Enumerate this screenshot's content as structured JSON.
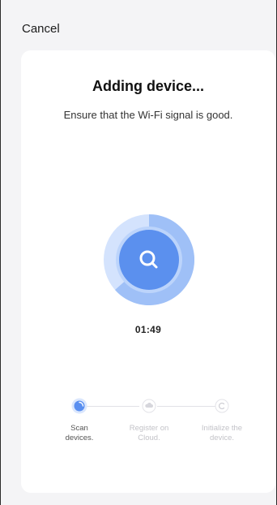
{
  "header": {
    "cancel_label": "Cancel"
  },
  "card": {
    "title": "Adding device...",
    "subtitle": "Ensure that the Wi-Fi signal is good.",
    "timer": "01:49"
  },
  "steps": [
    {
      "label_line1": "Scan",
      "label_line2": "devices.",
      "state": "active",
      "icon": "scan-dot-icon"
    },
    {
      "label_line1": "Register on",
      "label_line2": "Cloud.",
      "state": "pending",
      "icon": "cloud-icon"
    },
    {
      "label_line1": "Initialize the",
      "label_line2": "device.",
      "state": "pending",
      "icon": "initialize-icon"
    }
  ],
  "colors": {
    "accent": "#5a8ff0",
    "accent_light": "#cfe0ff",
    "ring_mid": "#8eb5f6",
    "inactive": "#e3e3e8",
    "text_muted": "#c3c3c8"
  }
}
